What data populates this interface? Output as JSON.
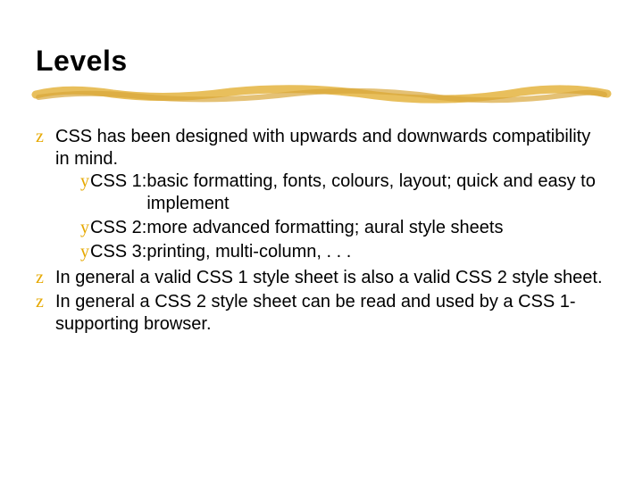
{
  "title": "Levels",
  "bullets": [
    {
      "marker": "z",
      "text": "CSS has been designed with upwards and downwards compatibility in mind.",
      "sub": [
        {
          "marker": "y",
          "label": "CSS 1:",
          "text": " basic formatting, fonts, colours, layout; quick and easy to implement"
        },
        {
          "marker": "y",
          "label": "CSS 2:",
          "text": " more advanced formatting; aural style sheets"
        },
        {
          "marker": "y",
          "label": "CSS 3:",
          "text": " printing, multi-column, . . ."
        }
      ]
    },
    {
      "marker": "z",
      "text": "In general a valid CSS 1 style sheet is also a valid CSS 2 style sheet."
    },
    {
      "marker": "z",
      "text": "In general a CSS 2 style sheet can be read and used by a CSS 1-supporting browser."
    }
  ],
  "colors": {
    "accent": "#e6a800"
  }
}
